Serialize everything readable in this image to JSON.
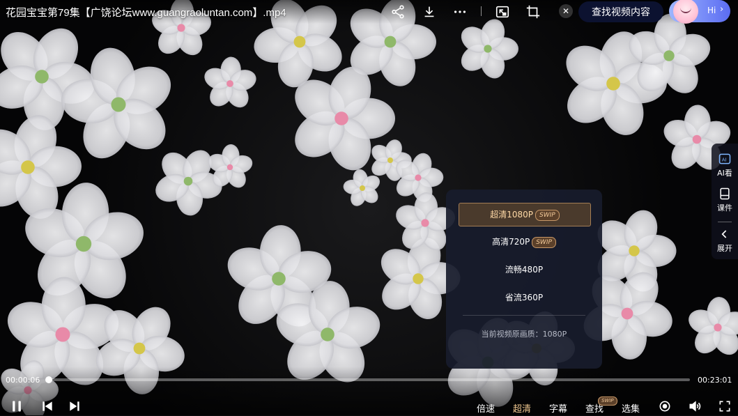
{
  "video": {
    "title": "花园宝宝第79集【广饶论坛www.guangraoluntan.com】.mp4"
  },
  "toolbar": {
    "icons": [
      "share-icon",
      "download-icon",
      "more-icon",
      "picture-in-picture-icon",
      "crop-icon",
      "close-icon"
    ],
    "find_button": "查找视频内容",
    "assistant_label": "Hi"
  },
  "side_panel": [
    {
      "label": "AI看",
      "icon": "ai-watch-icon"
    },
    {
      "label": "课件",
      "icon": "courseware-icon"
    },
    {
      "label": "展开",
      "icon": "chevron-left-icon"
    }
  ],
  "quality_menu": {
    "options": [
      {
        "label": "超清1080P",
        "badge": "SWIP",
        "selected": true
      },
      {
        "label": "高清720P",
        "badge": "SWIP",
        "selected": false
      },
      {
        "label": "流畅480P",
        "badge": "",
        "selected": false
      },
      {
        "label": "省流360P",
        "badge": "",
        "selected": false
      }
    ],
    "footer": "当前视频原画质：1080P"
  },
  "player": {
    "current_time": "00:00:06",
    "total_time": "00:23:01",
    "progress": 0.004
  },
  "controls": {
    "speed": "倍速",
    "quality": "超清",
    "subtitle": "字幕",
    "search": "查找",
    "search_badge": "SWIP",
    "episodes": "选集"
  },
  "colors": {
    "accent": "#f0c890",
    "find_button_bg": "#0c1230",
    "menu_bg": "#181c2c"
  }
}
